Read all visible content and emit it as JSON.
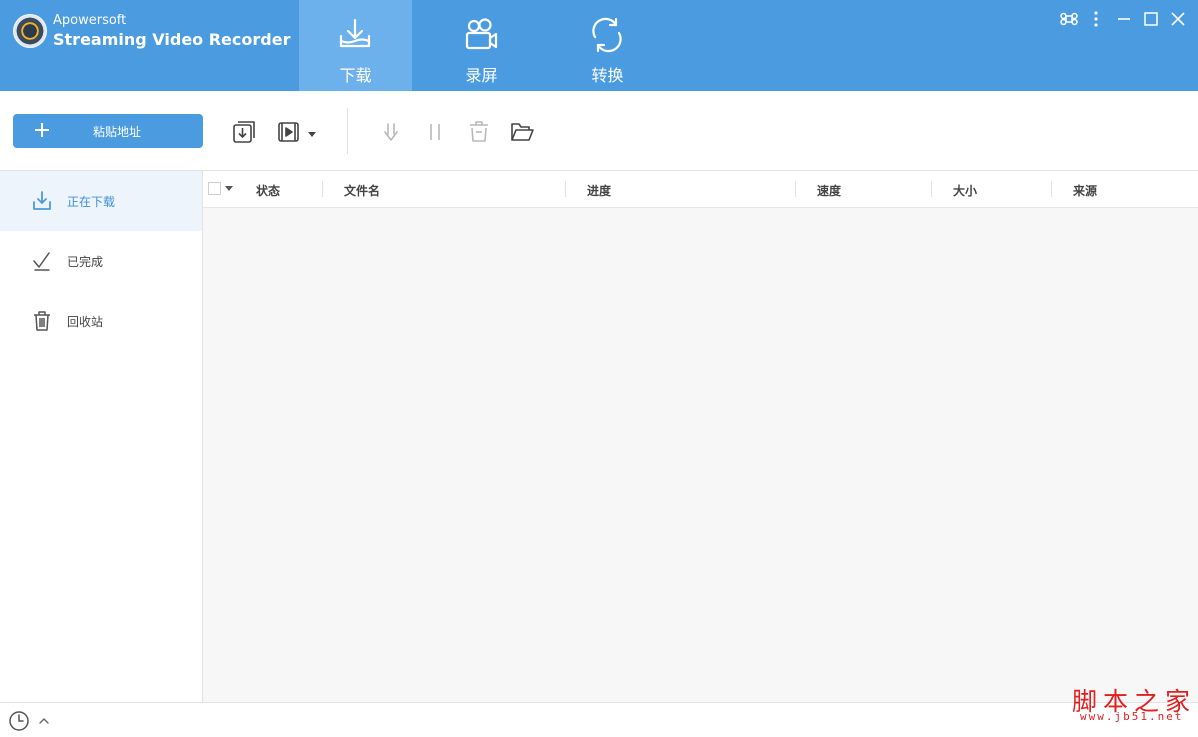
{
  "app": {
    "brand_small": "Apowersoft",
    "brand_name": "Streaming Video Recorder"
  },
  "nav": {
    "tabs": [
      {
        "label": "下载",
        "icon": "download-tray-icon",
        "active": true
      },
      {
        "label": "录屏",
        "icon": "video-camera-icon",
        "active": false
      },
      {
        "label": "转换",
        "icon": "convert-cycle-icon",
        "active": false
      }
    ]
  },
  "window_controls": [
    "command-icon",
    "more-vertical-icon",
    "minimize-icon",
    "maximize-icon",
    "close-icon"
  ],
  "toolbar": {
    "paste_label": "粘贴地址",
    "icons": [
      "batch-download-icon",
      "video-download-icon",
      "dropdown-caret-icon",
      "resume-icon",
      "pause-icon",
      "delete-icon",
      "open-folder-icon"
    ]
  },
  "sidebar": {
    "items": [
      {
        "label": "正在下载",
        "icon": "downloading-icon",
        "active": true
      },
      {
        "label": "已完成",
        "icon": "completed-check-icon",
        "active": false
      },
      {
        "label": "回收站",
        "icon": "trash-icon",
        "active": false
      }
    ]
  },
  "table": {
    "columns": [
      "状态",
      "文件名",
      "进度",
      "速度",
      "大小",
      "来源"
    ],
    "rows": []
  },
  "statusbar": {
    "watermark_cn": "脚本之家",
    "watermark_url": "www.jb51.net"
  },
  "colors": {
    "accent": "#4a9be0",
    "active_tab": "#6cb0ec",
    "sidebar_active_bg": "#eef4fb",
    "watermark": "#e02020"
  }
}
